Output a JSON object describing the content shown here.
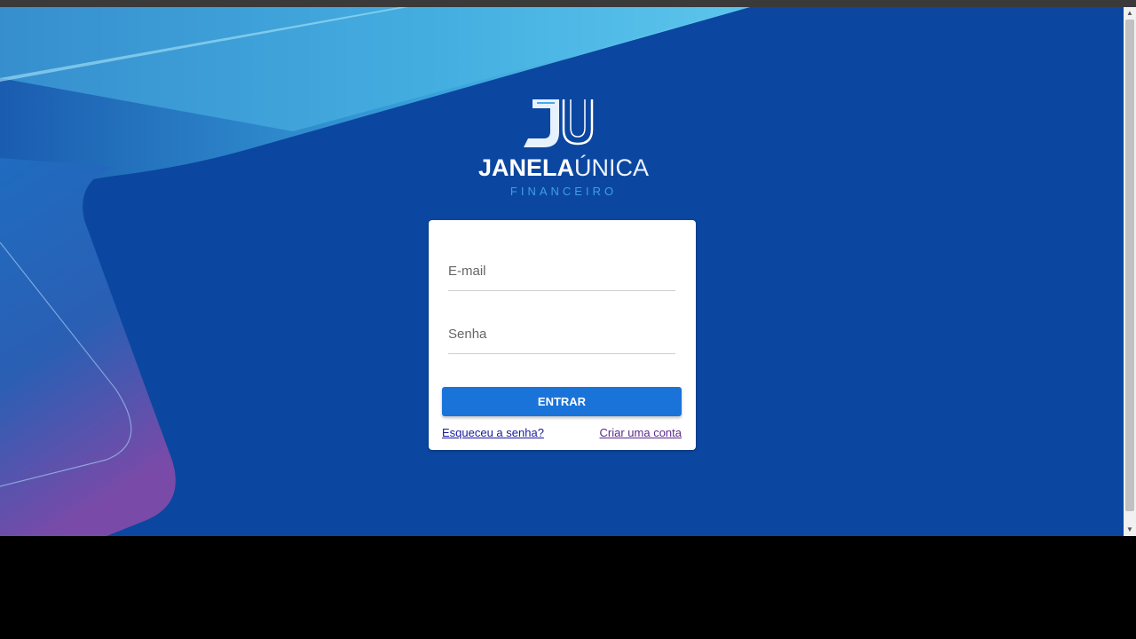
{
  "colors": {
    "background": "#0b47a0",
    "accent_light": "#5ccbf0",
    "button": "#1a73d9",
    "logo_subtitle": "#3aa0e8"
  },
  "logo": {
    "mark_icon": "ju-monogram-icon",
    "word_bold": "JANELA",
    "word_light": "ÚNICA",
    "subtitle": "FINANCEIRO"
  },
  "login": {
    "email_placeholder": "E-mail",
    "password_placeholder": "Senha",
    "submit_label": "ENTRAR",
    "forgot_label": "Esqueceu a senha?",
    "create_label": "Criar uma conta"
  }
}
